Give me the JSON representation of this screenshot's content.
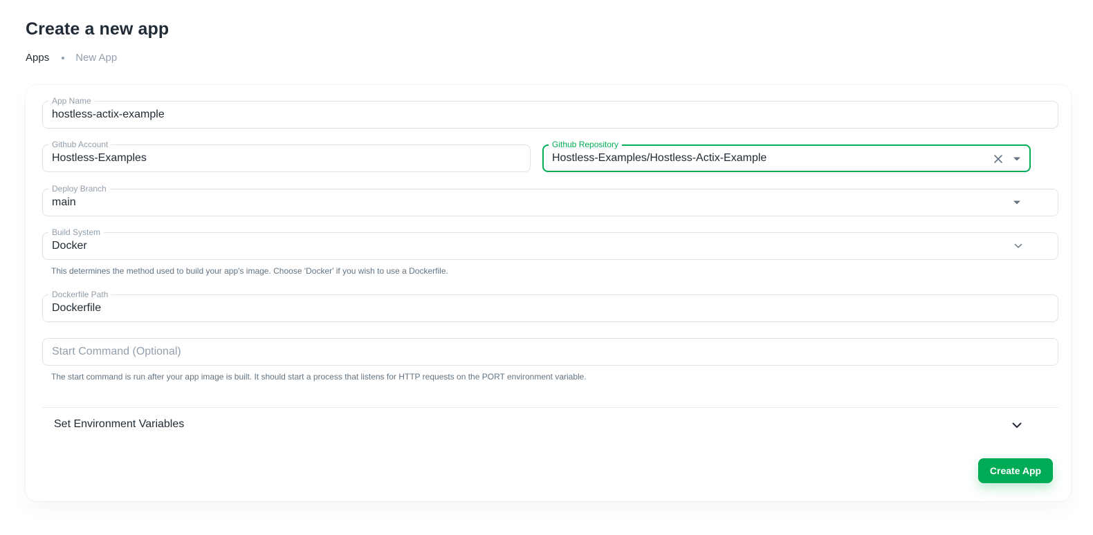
{
  "page": {
    "title": "Create a new app"
  },
  "breadcrumb": {
    "root": "Apps",
    "current": "New App"
  },
  "form": {
    "app_name": {
      "label": "App Name",
      "value": "hostless-actix-example"
    },
    "github_account": {
      "label": "Github Account",
      "value": "Hostless-Examples"
    },
    "github_repository": {
      "label": "Github Repository",
      "value": "Hostless-Examples/Hostless-Actix-Example"
    },
    "deploy_branch": {
      "label": "Deploy Branch",
      "value": "main"
    },
    "build_system": {
      "label": "Build System",
      "value": "Docker",
      "helper": "This determines the method used to build your app's image. Choose 'Docker' if you wish to use a Dockerfile."
    },
    "dockerfile_path": {
      "label": "Dockerfile Path",
      "value": "Dockerfile"
    },
    "start_command": {
      "placeholder": "Start Command (Optional)",
      "helper": "The start command is run after your app image is built. It should start a process that listens for HTTP requests on the PORT environment variable."
    },
    "env_vars": {
      "label": "Set Environment Variables"
    },
    "submit_label": "Create App"
  },
  "colors": {
    "primary": "#00ab55",
    "text": "#212b36",
    "muted": "#919eab",
    "border": "#dfe3e8"
  },
  "icons": {
    "clear": "close-icon",
    "dropdown": "caret-down-icon",
    "select": "chevron-down-icon",
    "accordion": "chevron-down-icon"
  }
}
